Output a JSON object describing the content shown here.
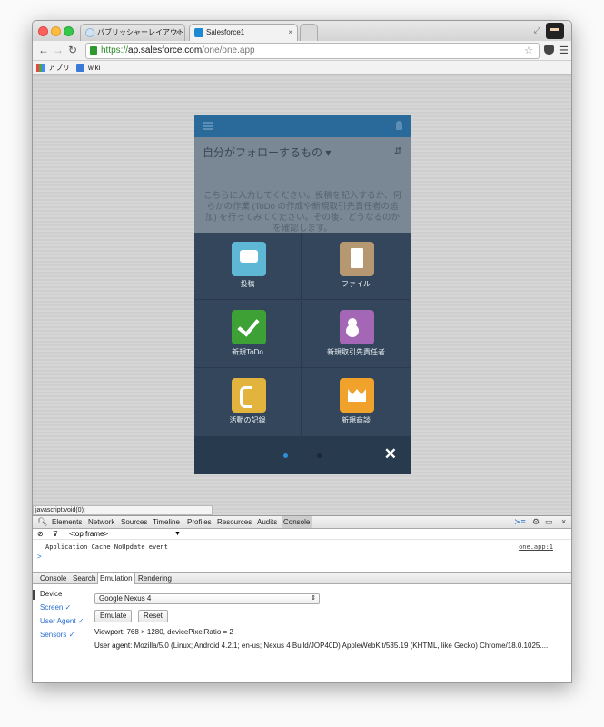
{
  "browser": {
    "tabs": [
      {
        "label": "パブリッシャーレイアウト",
        "close": "×"
      },
      {
        "label": "Salesforce1",
        "close": "×"
      }
    ],
    "url": {
      "scheme": "https://",
      "host": "ap.salesforce.com",
      "path": "/one/one.app"
    },
    "bookmarks": [
      {
        "label": "アプリ",
        "icon": "apps-grid-icon"
      },
      {
        "label": "wiki",
        "icon": "wiki-icon"
      }
    ]
  },
  "status_link": "javascript:void(0);",
  "sf": {
    "feed_title": "自分がフォローするもの ▾",
    "empty_text": "こちらに入力してください。投稿を記入するか、何らかの作業 (ToDo の作成や新規取引先責任者の追加) を行ってみてください。その後、どうなるのかを確認します。",
    "actions": [
      {
        "label": "投稿",
        "icon": "post-chat-icon",
        "color": "#5fb7d6"
      },
      {
        "label": "ファイル",
        "icon": "file-icon",
        "color": "#b59872"
      },
      {
        "label": "新規ToDo",
        "icon": "checkmark-icon",
        "color": "#3ea135"
      },
      {
        "label": "新規取引先責任者",
        "icon": "contact-card-icon",
        "color": "#a467b6"
      },
      {
        "label": "活動の記録",
        "icon": "phone-log-icon",
        "color": "#e3b43d"
      },
      {
        "label": "新規商談",
        "icon": "crown-icon",
        "color": "#f0a22b"
      }
    ],
    "close_label": "✕"
  },
  "devtools": {
    "tabs": [
      "Elements",
      "Network",
      "Sources",
      "Timeline",
      "Profiles",
      "Resources",
      "Audits",
      "Console"
    ],
    "frame": "<top frame>",
    "console_message": "Application Cache NoUpdate event",
    "console_source": "one.app:1",
    "prompt": ">",
    "drawer_tabs": [
      "Console",
      "Search",
      "Emulation",
      "Rendering"
    ],
    "emulation": {
      "side": [
        "Device",
        "Screen ✓",
        "User Agent ✓",
        "Sensors ✓"
      ],
      "device": "Google Nexus 4",
      "emulate_label": "Emulate",
      "reset_label": "Reset",
      "viewport_label": "Viewport:",
      "viewport_value": "768 × 1280, devicePixelRatio = 2",
      "ua_label": "User agent:",
      "ua_value": "Mozilla/5.0 (Linux; Android 4.2.1; en-us; Nexus 4 Build/JOP40D) AppleWebKit/535.19 (KHTML, like Gecko) Chrome/18.0.1025...."
    }
  }
}
